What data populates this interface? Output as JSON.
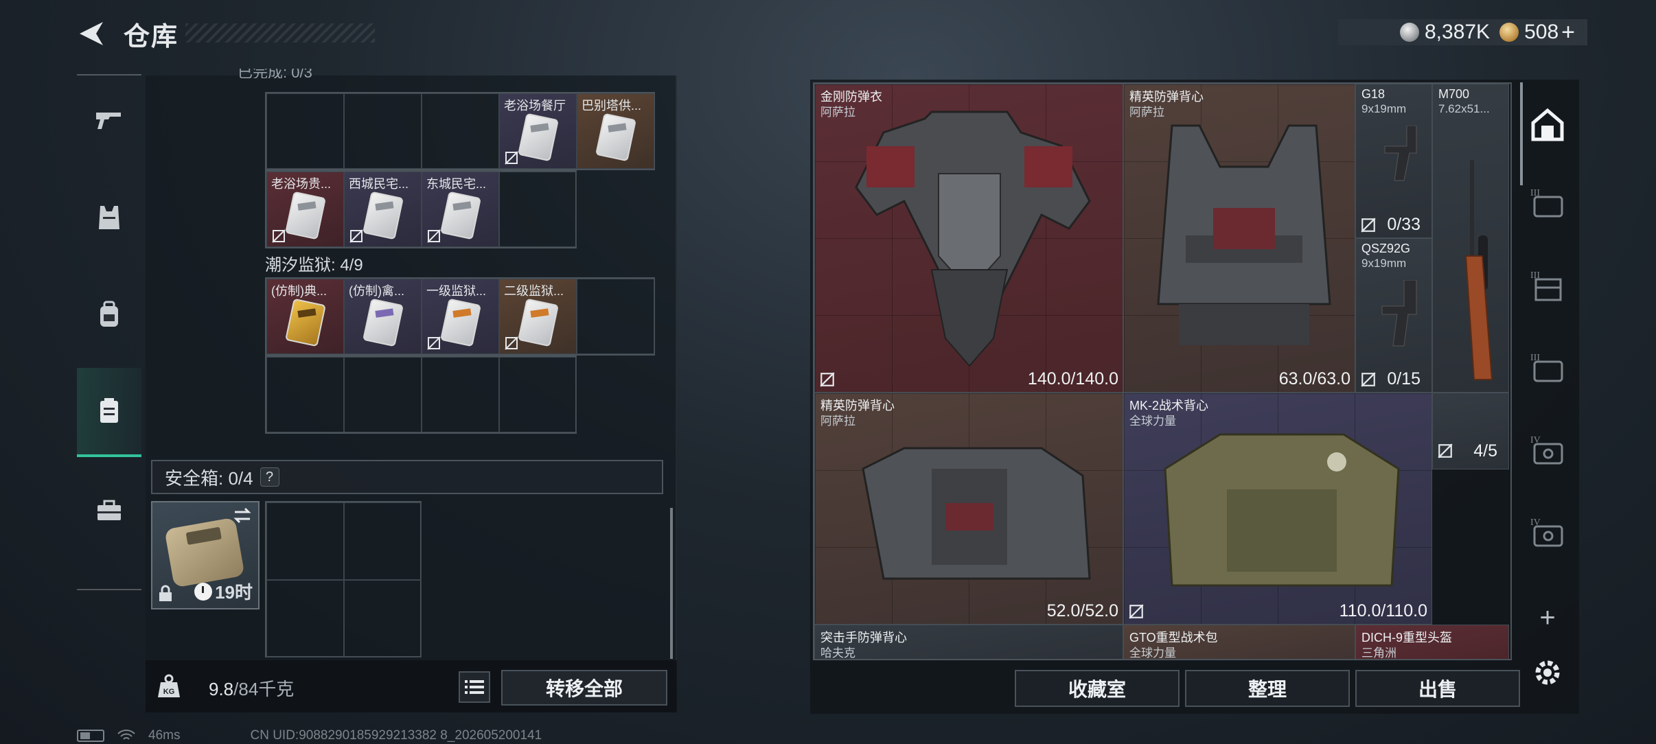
{
  "header": {
    "title": "仓库",
    "currency": [
      {
        "icon": "silver-coin-icon",
        "value": "8,387K"
      },
      {
        "icon": "gold-coin-icon",
        "value": "508"
      }
    ],
    "add_label": "+"
  },
  "left_sidebar": {
    "items": [
      {
        "name": "weapons",
        "icon": "pistol-icon"
      },
      {
        "name": "armor",
        "icon": "vest-icon"
      },
      {
        "name": "backpack",
        "icon": "backpack-icon"
      },
      {
        "name": "containers",
        "icon": "case-icon",
        "active": true
      },
      {
        "name": "toolbox",
        "icon": "toolbox-icon"
      }
    ]
  },
  "keys": {
    "top_cut_label": "已完成: 0/3",
    "row1": [
      {
        "label": "老浴场餐厅",
        "rarity": "purple"
      },
      {
        "label": "巴别塔供...",
        "rarity": "brown"
      }
    ],
    "row2": [
      {
        "label": "老浴场贵...",
        "rarity": "red"
      },
      {
        "label": "西城民宅...",
        "rarity": "purple"
      },
      {
        "label": "东城民宅...",
        "rarity": "purple"
      }
    ],
    "section2_label": "潮汐监狱: 4/9",
    "row3": [
      {
        "label": "(仿制)典...",
        "rarity": "red"
      },
      {
        "label": "(仿制)禽...",
        "rarity": "purple"
      },
      {
        "label": "一级监狱...",
        "rarity": "purple"
      },
      {
        "label": "二级监狱...",
        "rarity": "brown"
      }
    ]
  },
  "safe_box": {
    "label": "安全箱: 0/4",
    "help": "?",
    "timer": "19时"
  },
  "left_footer": {
    "weight_current": "9.8",
    "weight_max": "/84千克",
    "weight_badge": "KG",
    "transfer_all": "转移全部"
  },
  "inventory": {
    "items": [
      {
        "name": "金刚防弹衣",
        "sub": "阿萨拉",
        "durability": "140.0/140.0",
        "rarity": "red"
      },
      {
        "name": "精英防弹背心",
        "sub": "阿萨拉",
        "durability": "63.0/63.0",
        "rarity": "brown"
      },
      {
        "name": "G18",
        "sub": "9x19mm",
        "ammo": "0/33",
        "rarity": "gray"
      },
      {
        "name": "M700",
        "sub": "7.62x51...",
        "rarity": "gray"
      },
      {
        "name": "QSZ92G",
        "sub": "9x19mm",
        "ammo": "0/15",
        "rarity": "gray"
      },
      {
        "name": "精英防弹背心",
        "sub": "阿萨拉",
        "durability": "52.0/52.0",
        "rarity": "brown"
      },
      {
        "name": "MK-2战术背心",
        "sub": "全球力量",
        "durability": "110.0/110.0",
        "rarity": "purple"
      },
      {
        "name": "",
        "sub": "",
        "ammo": "4/5",
        "rarity": "gray"
      },
      {
        "name": "突击手防弹背心",
        "sub": "哈夫克",
        "rarity": "gray"
      },
      {
        "name": "GTO重型战术包",
        "sub": "全球力量",
        "rarity": "brown"
      },
      {
        "name": "DICH-9重型头盔",
        "sub": "三角洲",
        "rarity": "red"
      }
    ]
  },
  "right_footer": {
    "collection": "收藏室",
    "sort": "整理",
    "sell": "出售"
  },
  "right_sidebar": {
    "add_label": "+",
    "items": [
      "warehouse-icon",
      "tier3-case-icon",
      "tier3-crate-icon",
      "tier3-case-icon",
      "tier4-case-icon",
      "tier4-case-icon",
      "add-icon",
      "settings-gear-icon"
    ]
  },
  "status_bar": {
    "ping": "46ms",
    "uid": "CN UID:9088290185929213382 8_202605200141"
  },
  "colors": {
    "accent": "#33c39a",
    "rarity_red": "#5b2e35",
    "rarity_brown": "#52403a",
    "rarity_purple": "#3f3d58"
  }
}
